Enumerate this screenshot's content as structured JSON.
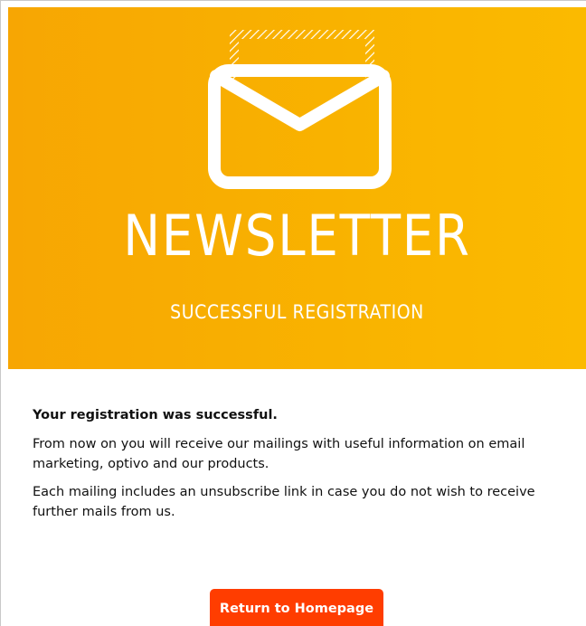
{
  "hero": {
    "icon": "envelope-icon",
    "title": "NEWSLETTER",
    "subtitle": "SUCCESSFUL REGISTRATION",
    "background_color": "#f9b300",
    "text_color": "#ffffff"
  },
  "content": {
    "headline": "Your registration was successful.",
    "paragraph1": "From now on you will receive our mailings with useful information on email marketing, optivo and our products.",
    "paragraph2": "Each mailing includes an unsubscribe link in case you do not wish to receive further mails from us."
  },
  "cta": {
    "label": "Return to Homepage",
    "color": "#ff3d00"
  }
}
